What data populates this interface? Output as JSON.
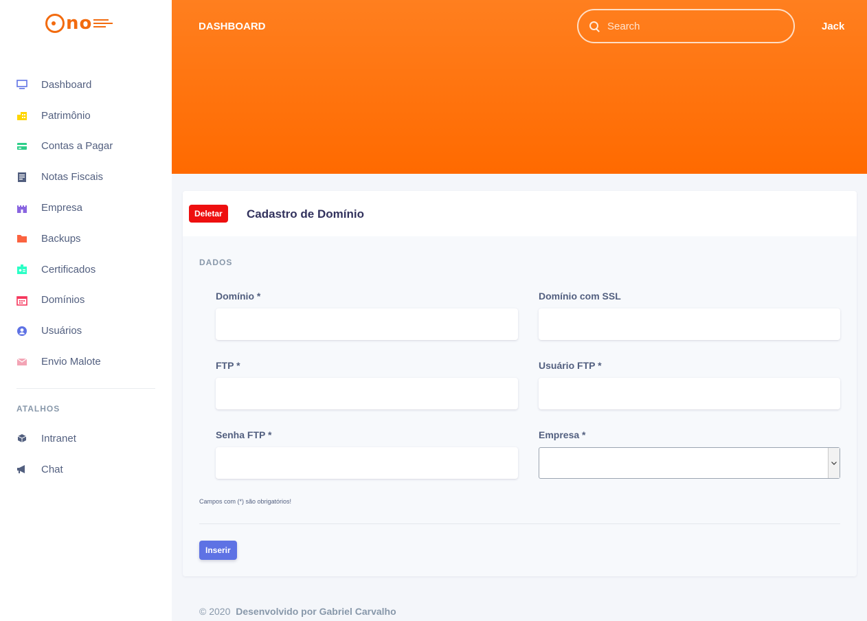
{
  "sidebar": {
    "logo": "uno",
    "items": [
      {
        "label": "Dashboard",
        "icon": "monitor-icon",
        "color": "#5e72e4"
      },
      {
        "label": "Patrimônio",
        "icon": "buildings-icon",
        "color": "#ffd600"
      },
      {
        "label": "Contas a Pagar",
        "icon": "credit-card-icon",
        "color": "#2dce89"
      },
      {
        "label": "Notas Fiscais",
        "icon": "document-icon",
        "color": "#525f7f"
      },
      {
        "label": "Empresa",
        "icon": "castle-icon",
        "color": "#8965e0"
      },
      {
        "label": "Backups",
        "icon": "folder-icon",
        "color": "#fb6340"
      },
      {
        "label": "Certificados",
        "icon": "badge-icon",
        "color": "#2bffc6"
      },
      {
        "label": "Domínios",
        "icon": "calendar-icon",
        "color": "#f5365c"
      },
      {
        "label": "Usuários",
        "icon": "user-icon",
        "color": "#5e72e4"
      },
      {
        "label": "Envio Malote",
        "icon": "envelope-icon",
        "color": "#f3a4b5"
      }
    ],
    "section_title": "ATALHOS",
    "shortcuts": [
      {
        "label": "Intranet",
        "icon": "cube-icon",
        "color": "#525f7f"
      },
      {
        "label": "Chat",
        "icon": "megaphone-icon",
        "color": "#525f7f"
      }
    ]
  },
  "header": {
    "title": "DASHBOARD",
    "search_placeholder": "Search",
    "user": "Jack",
    "gradient_color": "#ff7214"
  },
  "card": {
    "delete_label": "Deletar",
    "title": "Cadastro de Domínio",
    "section": "DADOS",
    "fields": {
      "dominio": {
        "label": "Domínio *",
        "value": ""
      },
      "dominio_ssl": {
        "label": "Domínio com SSL",
        "value": ""
      },
      "ftp": {
        "label": "FTP *",
        "value": ""
      },
      "usuario_ftp": {
        "label": "Usuário FTP *",
        "value": ""
      },
      "senha_ftp": {
        "label": "Senha FTP *",
        "value": ""
      },
      "empresa": {
        "label": "Empresa *",
        "value": ""
      }
    },
    "required_note": "Campos com (*) são obrigatórios!",
    "insert_label": "Inserir"
  },
  "footer": {
    "copyright": "© 2020",
    "credit": "Desenvolvido por Gabriel Carvalho"
  }
}
